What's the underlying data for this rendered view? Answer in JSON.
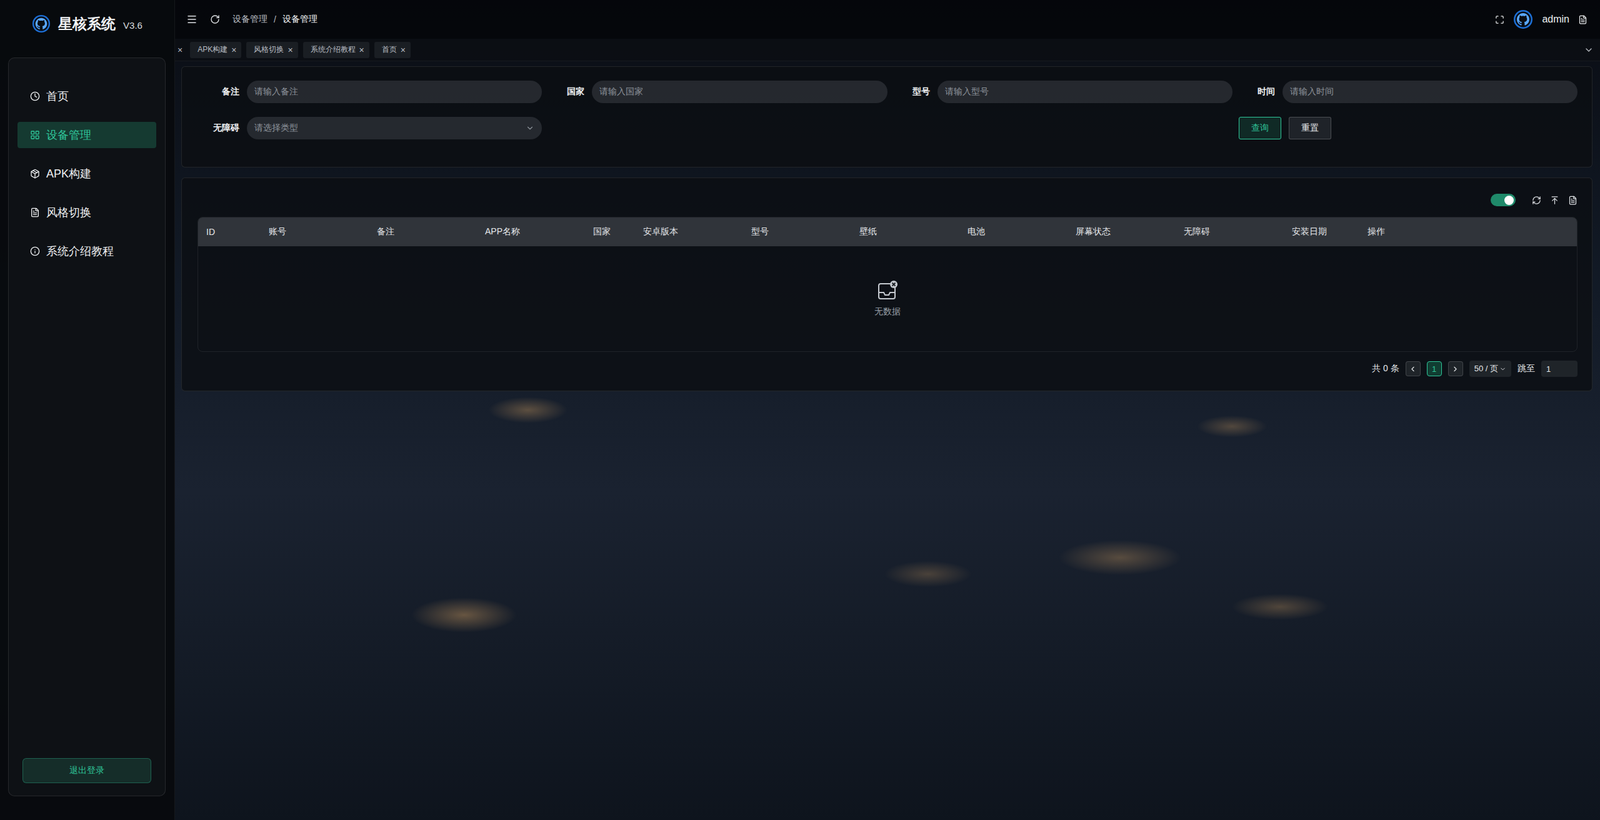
{
  "app": {
    "logo_title": "星核系统",
    "version": "V3.6"
  },
  "sidebar": {
    "items": [
      {
        "label": "首页",
        "selected": false
      },
      {
        "label": "设备管理",
        "selected": true
      },
      {
        "label": "APK构建",
        "selected": false
      },
      {
        "label": "风格切换",
        "selected": false
      },
      {
        "label": "系统介绍教程",
        "selected": false
      }
    ],
    "logout": "退出登录"
  },
  "topbar": {
    "breadcrumb": [
      "设备管理",
      "设备管理"
    ],
    "separator": "/",
    "user": "admin"
  },
  "tabs": {
    "close": "×",
    "items": [
      {
        "label": "",
        "selected": false
      },
      {
        "label": "APK构建",
        "selected": false
      },
      {
        "label": "风格切换",
        "selected": false
      },
      {
        "label": "系统介绍教程",
        "selected": false
      },
      {
        "label": "首页",
        "selected": false
      }
    ]
  },
  "search": {
    "fields": [
      {
        "label": "备注",
        "placeholder": "请输入备注",
        "kind": "input"
      },
      {
        "label": "国家",
        "placeholder": "请输入国家",
        "kind": "input"
      },
      {
        "label": "型号",
        "placeholder": "请输入型号",
        "kind": "input"
      },
      {
        "label": "时间",
        "placeholder": "请输入时间",
        "kind": "input"
      },
      {
        "label": "无障碍",
        "placeholder": "请选择类型",
        "kind": "select"
      }
    ],
    "query": "查询",
    "reset": "重置"
  },
  "table": {
    "toggle_on": true,
    "columns": [
      "ID",
      "账号",
      "备注",
      "APP名称",
      "国家",
      "安卓版本",
      "型号",
      "壁纸",
      "电池",
      "屏幕状态",
      "无障碍",
      "安装日期",
      "操作"
    ],
    "rows": [],
    "empty": "无数据"
  },
  "pagination": {
    "total": "共 0 条",
    "pages": [
      {
        "label": "1",
        "selected": true
      }
    ],
    "page_size": "50 / 页",
    "jump_label": "跳至",
    "jump_value": "1"
  }
}
